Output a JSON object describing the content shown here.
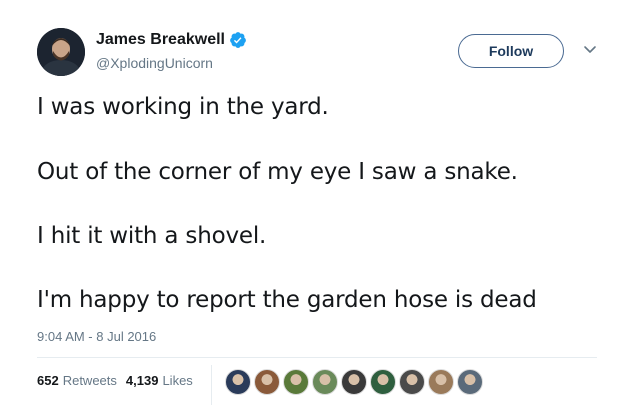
{
  "tweet": {
    "author": {
      "name": "James Breakwell",
      "handle": "@XplodingUnicorn",
      "verified": true
    },
    "follow_label": "Follow",
    "lines": [
      "I was working in the yard.",
      "Out of the corner of my eye I saw a snake.",
      "I hit it with a shovel.",
      "I'm happy to report the garden hose is dead"
    ],
    "timestamp": "9:04 AM - 8 Jul 2016",
    "retweets": {
      "count": "652",
      "label": "Retweets"
    },
    "likes": {
      "count": "4,139",
      "label": "Likes"
    }
  },
  "colors": {
    "text": "#14171a",
    "secondary": "#657786",
    "verified_badge": "#1da1f2",
    "follow_border": "#4a6a92",
    "divider": "#e6ecf0"
  },
  "facepile": [
    {
      "icon": "liker-avatar-1",
      "color": "#2a3b5a"
    },
    {
      "icon": "liker-avatar-2",
      "color": "#8a5a3a"
    },
    {
      "icon": "liker-avatar-3",
      "color": "#5a7a3a"
    },
    {
      "icon": "liker-avatar-4",
      "color": "#6a8a5a"
    },
    {
      "icon": "liker-avatar-5",
      "color": "#3a3a3a"
    },
    {
      "icon": "liker-avatar-6",
      "color": "#2f5f3f"
    },
    {
      "icon": "liker-avatar-7",
      "color": "#4a4a4a"
    },
    {
      "icon": "liker-avatar-8",
      "color": "#9a7a5a"
    },
    {
      "icon": "liker-avatar-9",
      "color": "#5a6a7a"
    }
  ]
}
